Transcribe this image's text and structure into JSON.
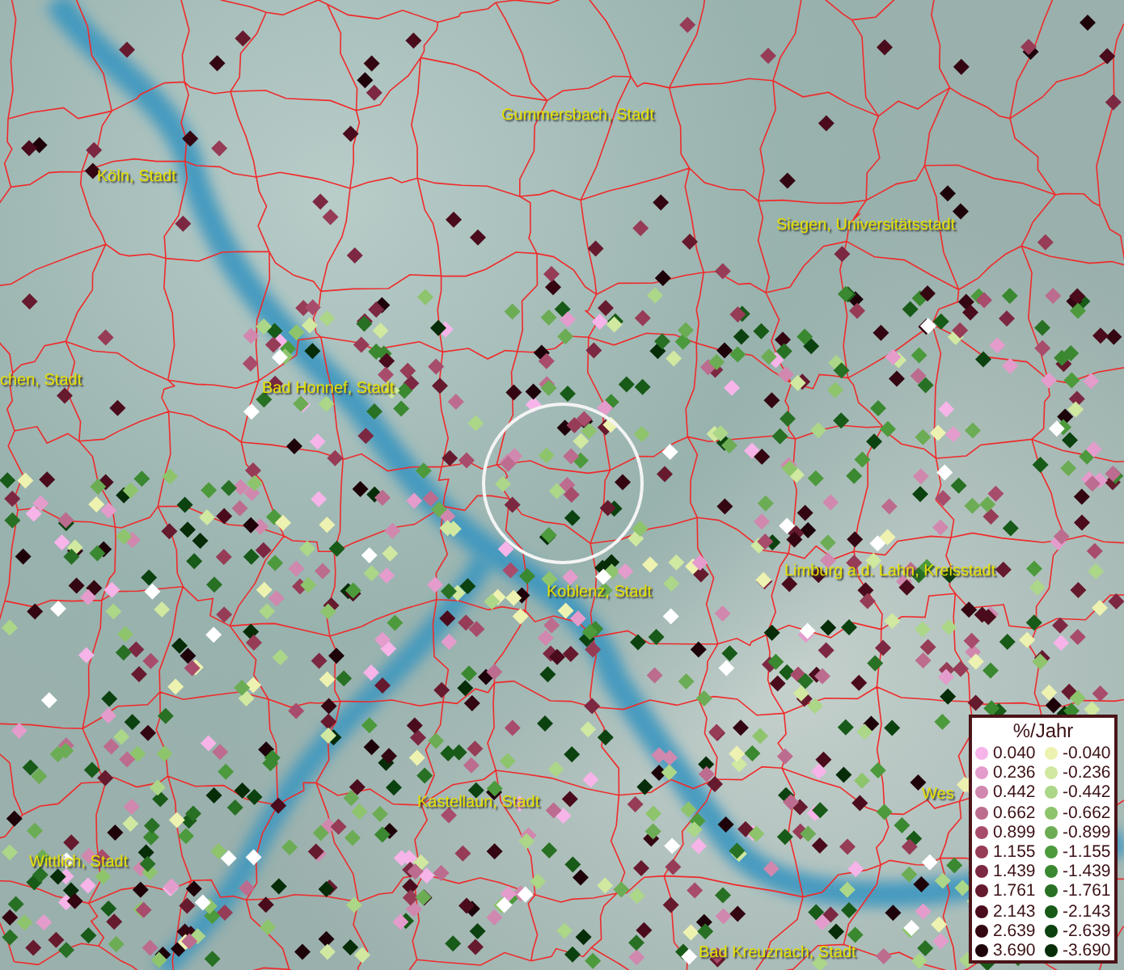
{
  "map": {
    "places": [
      {
        "label": "Gummersbach, Stadt"
      },
      {
        "label": "Köln, Stadt"
      },
      {
        "label": "Siegen, Universitätsstadt"
      },
      {
        "label": "chen, Stadt"
      },
      {
        "label": "Bad Honnef, Stadt"
      },
      {
        "label": "Limburg a.d. Lahn, Kreisstadt"
      },
      {
        "label": "Koblenz, Stadt"
      },
      {
        "label": "Kastellaun, Stadt"
      },
      {
        "label": "Wes"
      },
      {
        "label": "Wittlich, Stadt"
      },
      {
        "label": "Bad Kreuznach, Stadt"
      }
    ]
  },
  "legend": {
    "title": "%/Jahr",
    "rows": [
      {
        "positive": {
          "value": "0.040",
          "color": "#f6b4e8"
        },
        "negative": {
          "value": "-0.040",
          "color": "#eef2b0"
        }
      },
      {
        "positive": {
          "value": "0.236",
          "color": "#e49ccc"
        },
        "negative": {
          "value": "-0.236",
          "color": "#d0e8a0"
        }
      },
      {
        "positive": {
          "value": "0.442",
          "color": "#d088ae"
        },
        "negative": {
          "value": "-0.442",
          "color": "#acd688"
        }
      },
      {
        "positive": {
          "value": "0.662",
          "color": "#bc6c8e"
        },
        "negative": {
          "value": "-0.662",
          "color": "#8ec46c"
        }
      },
      {
        "positive": {
          "value": "0.899",
          "color": "#a84c6c"
        },
        "negative": {
          "value": "-0.899",
          "color": "#6cac54"
        }
      },
      {
        "positive": {
          "value": "1.155",
          "color": "#963c56"
        },
        "negative": {
          "value": "-1.155",
          "color": "#4c9a3c"
        }
      },
      {
        "positive": {
          "value": "1.439",
          "color": "#7c2842"
        },
        "negative": {
          "value": "-1.439",
          "color": "#3a8830"
        }
      },
      {
        "positive": {
          "value": "1.761",
          "color": "#661a2e"
        },
        "negative": {
          "value": "-1.761",
          "color": "#287024"
        }
      },
      {
        "positive": {
          "value": "2.143",
          "color": "#4a0c1c"
        },
        "negative": {
          "value": "-2.143",
          "color": "#185a18"
        }
      },
      {
        "positive": {
          "value": "2.639",
          "color": "#340612"
        },
        "negative": {
          "value": "-2.639",
          "color": "#0c4210"
        }
      },
      {
        "positive": {
          "value": "3.690",
          "color": "#1e020a"
        },
        "negative": {
          "value": "-3.690",
          "color": "#062c08"
        }
      }
    ]
  }
}
